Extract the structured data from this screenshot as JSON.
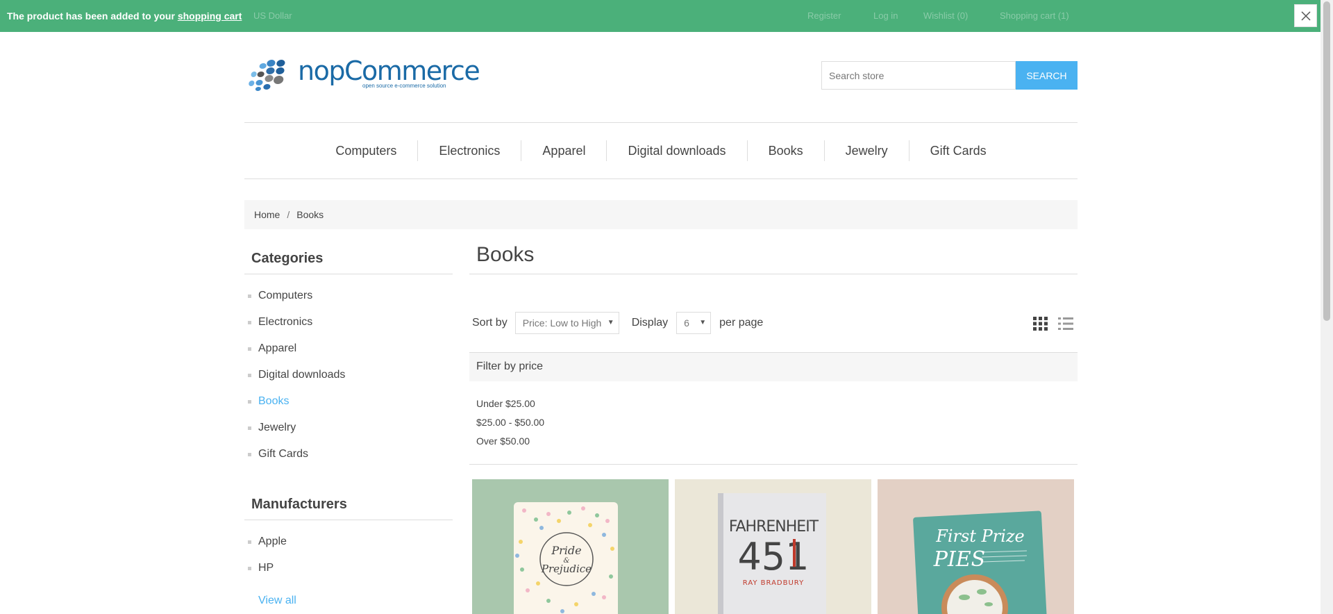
{
  "notification": {
    "text": "The product has been added to your ",
    "link": "shopping cart"
  },
  "header_links": {
    "currency": "US Dollar",
    "register": "Register",
    "login": "Log in",
    "wishlist": "Wishlist (0)",
    "cart": "Shopping cart (1)"
  },
  "logo": {
    "brand": "nopCommerce",
    "tagline": "open source e-commerce solution"
  },
  "search": {
    "placeholder": "Search store",
    "button": "SEARCH"
  },
  "top_menu": [
    "Computers",
    "Electronics",
    "Apparel",
    "Digital downloads",
    "Books",
    "Jewelry",
    "Gift Cards"
  ],
  "breadcrumb": {
    "home": "Home",
    "separator": "/",
    "current": "Books"
  },
  "sidebar": {
    "categories_title": "Categories",
    "categories": [
      "Computers",
      "Electronics",
      "Apparel",
      "Digital downloads",
      "Books",
      "Jewelry",
      "Gift Cards"
    ],
    "active_category": "Books",
    "manufacturers_title": "Manufacturers",
    "manufacturers": [
      "Apple",
      "HP"
    ],
    "view_all": "View all"
  },
  "main": {
    "title": "Books",
    "sort_label": "Sort by",
    "sort_value": "Price: Low to High",
    "display_label": "Display",
    "display_value": "6",
    "per_page": "per page",
    "filter_title": "Filter by price",
    "filters": [
      "Under $25.00",
      "$25.00 - $50.00",
      "Over $50.00"
    ]
  },
  "products": [
    {
      "cover_line1": "Pride",
      "cover_line2": "&",
      "cover_line3": "Prejudice"
    },
    {
      "cover_line1": "FAHRENHEIT",
      "cover_line2": "451",
      "cover_line3": "RAY BRADBURY"
    },
    {
      "cover_line1": "First Prize",
      "cover_line2": "PIES",
      "cover_line3": ""
    }
  ],
  "colors": {
    "notification_bg": "#4bb07a",
    "accent": "#4ab2f1",
    "text": "#444444"
  }
}
